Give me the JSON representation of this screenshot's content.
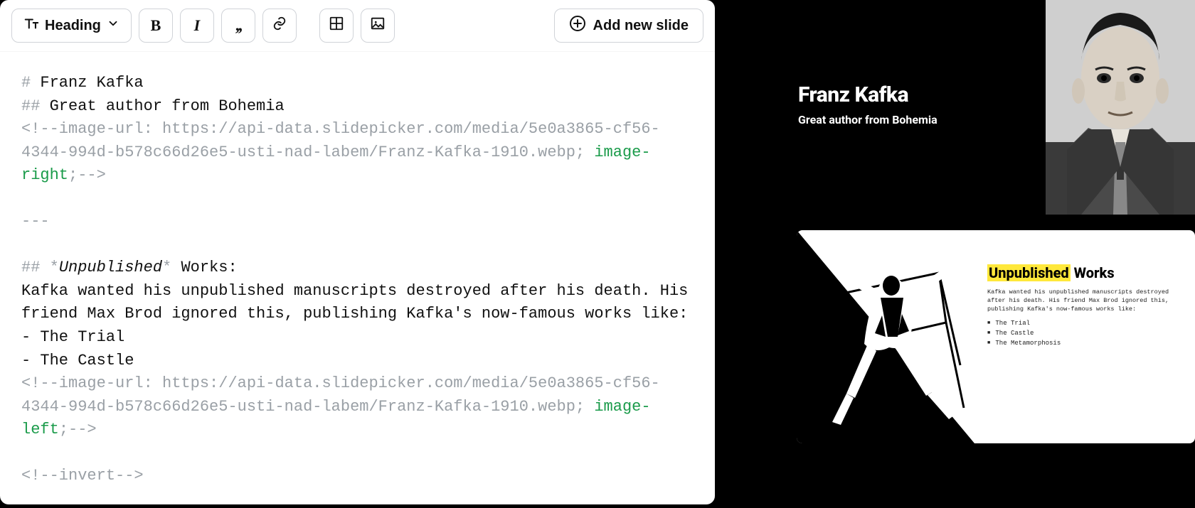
{
  "toolbar": {
    "heading_label": "Heading",
    "add_slide_label": "Add new slide"
  },
  "editor": {
    "line1_hash": "# ",
    "line1_text": "Franz Kafka",
    "line2_hash": "## ",
    "line2_text": "Great author from Bohemia",
    "comment1_a": "<!--image-url: https://api-data.slidepicker.com/media/5e0a3865-cf56-4344-994d-b578c66d26e5-usti-nad-labem/Franz-Kafka-1910.webp; ",
    "comment1_key": "image-right",
    "comment1_b": ";-->",
    "sep": "---",
    "unpub_hash": "## ",
    "unpub_star1": "*",
    "unpub_em": "Unpublished",
    "unpub_star2": "*",
    "unpub_rest": " Works:",
    "body1": "Kafka wanted his unpublished manuscripts destroyed after his death. His friend Max Brod ignored this, publishing Kafka's now-famous works like:",
    "li1": "- The Trial",
    "li2": "- The Castle",
    "comment2_a": "<!--image-url: https://api-data.slidepicker.com/media/5e0a3865-cf56-4344-994d-b578c66d26e5-usti-nad-labem/Franz-Kafka-1910.webp; ",
    "comment2_key": "image-left",
    "comment2_b": ";-->",
    "invert": "<!--invert-->"
  },
  "slide1": {
    "title": "Franz Kafka",
    "subtitle": "Great author from Bohemia"
  },
  "slide2": {
    "title_hl": "Unpublished",
    "title_rest": " Works",
    "desc": "Kafka wanted his unpublished manuscripts destroyed after his death. His friend Max Brod ignored this, publishing Kafka's now-famous works like:",
    "items": [
      "The Trial",
      "The Castle",
      "The Metamorphosis"
    ]
  }
}
